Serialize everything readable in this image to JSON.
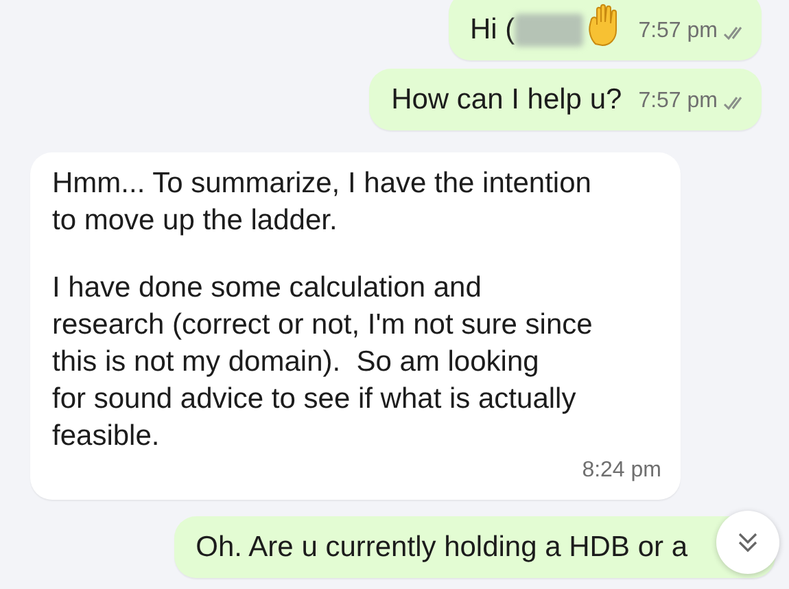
{
  "messages": [
    {
      "kind": "outgoing",
      "text": "Hi (",
      "redacted": true,
      "hand_emoji": true,
      "time": "7:57 pm",
      "read": false
    },
    {
      "kind": "outgoing",
      "text": "How can I help u?",
      "time": "7:57 pm",
      "read": false
    },
    {
      "kind": "incoming",
      "text": "Hmm... To summarize, I have the intention\nto move up the ladder.\n\nI have done some calculation and\nresearch (correct or not, I'm not sure since\nthis is not my domain).  So am looking\nfor sound advice to see if what is actually\nfeasible.",
      "time": "8:24 pm"
    },
    {
      "kind": "outgoing",
      "text": "Oh. Are u currently holding a HDB or a"
    }
  ],
  "scroll_button": {
    "visible": true
  }
}
